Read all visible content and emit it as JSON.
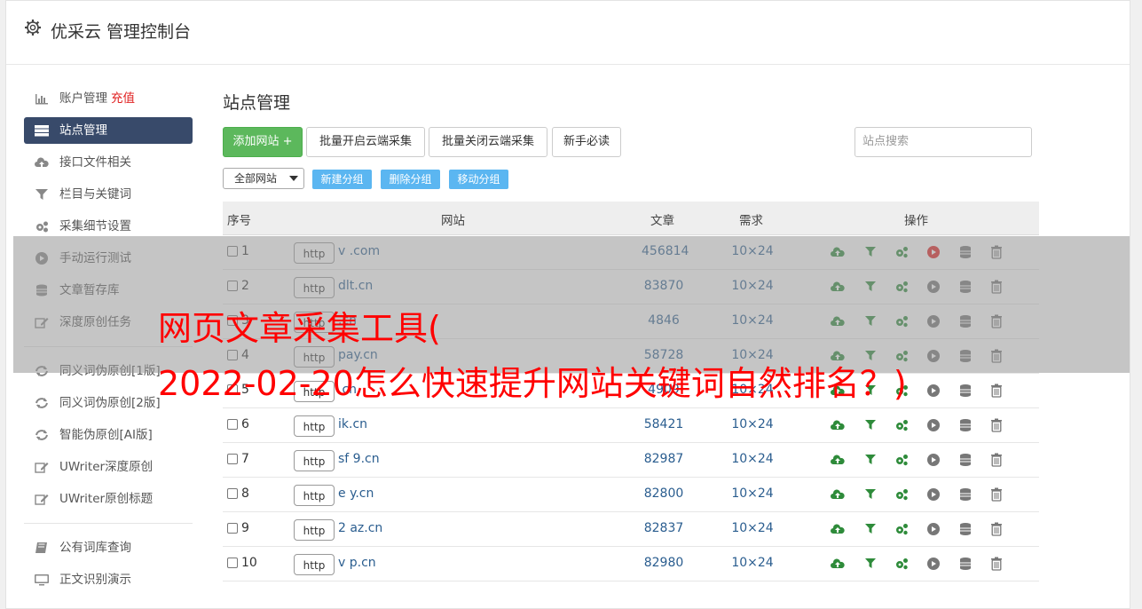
{
  "header": {
    "title": "优采云 管理控制台"
  },
  "sidebar": {
    "items": [
      {
        "label": "账户管理",
        "extra": "充值",
        "icon": "bar-chart-icon"
      },
      {
        "label": "站点管理",
        "icon": "server-icon",
        "active": true
      },
      {
        "label": "接口文件相关",
        "icon": "cloud-upload-icon"
      },
      {
        "label": "栏目与关键词",
        "icon": "filter-icon"
      },
      {
        "label": "采集细节设置",
        "icon": "gears-icon"
      },
      {
        "label": "手动运行测试",
        "icon": "play-icon"
      },
      {
        "label": "文章暂存库",
        "icon": "database-icon"
      },
      {
        "label": "深度原创任务",
        "icon": "edit-icon"
      },
      {
        "label": "同义词伪原创[1版]",
        "icon": "refresh-icon"
      },
      {
        "label": "同义词伪原创[2版]",
        "icon": "refresh-icon"
      },
      {
        "label": "智能伪原创[AI版]",
        "icon": "refresh-icon"
      },
      {
        "label": "UWriter深度原创",
        "icon": "edit-icon"
      },
      {
        "label": "UWriter原创标题",
        "icon": "edit-icon"
      },
      {
        "label": "公有词库查询",
        "icon": "book-icon"
      },
      {
        "label": "正文识别演示",
        "icon": "monitor-icon"
      }
    ]
  },
  "main": {
    "title": "站点管理",
    "toolbar": {
      "add": "添加网站 +",
      "batch_open": "批量开启云端采集",
      "batch_close": "批量关闭云端采集",
      "newbie": "新手必读",
      "search_placeholder": "站点搜索"
    },
    "group": {
      "select_value": "全部网站",
      "new_group": "新建分组",
      "delete_group": "删除分组",
      "move_group": "移动分组"
    },
    "table": {
      "headers": [
        "序号",
        "网站",
        "文章",
        "需求",
        "操作"
      ],
      "rows": [
        {
          "no": "1",
          "proto": "http",
          "site": "v           .com",
          "articles": "456814",
          "demand": "10×24"
        },
        {
          "no": "2",
          "proto": "http",
          "site": "      dlt.cn",
          "articles": "83870",
          "demand": "10×24"
        },
        {
          "no": "3",
          "proto": "http",
          "site": "          .cn",
          "articles": "4846",
          "demand": "10×24"
        },
        {
          "no": "4",
          "proto": "http",
          "site": "        pay.cn",
          "articles": "58728",
          "demand": "10×24"
        },
        {
          "no": "5",
          "proto": "http",
          "site": "         .cn",
          "articles": "4909",
          "demand": "10×24"
        },
        {
          "no": "6",
          "proto": "http",
          "site": "      ik.cn",
          "articles": "58421",
          "demand": "10×24"
        },
        {
          "no": "7",
          "proto": "http",
          "site": "sf   9.cn",
          "articles": "82987",
          "demand": "10×24"
        },
        {
          "no": "8",
          "proto": "http",
          "site": "e      y.cn",
          "articles": "82800",
          "demand": "10×24"
        },
        {
          "no": "9",
          "proto": "http",
          "site": "2      az.cn",
          "articles": "82837",
          "demand": "10×24"
        },
        {
          "no": "10",
          "proto": "http",
          "site": "v     p.cn",
          "articles": "82980",
          "demand": "10×24"
        }
      ]
    }
  },
  "overlay": {
    "line1": "网页文章采集工具(",
    "line2": "2022-02-20怎么快速提升网站关键词自然排名？)"
  },
  "colors": {
    "active_bg": "#384a6a",
    "green": "#5cb85c",
    "link_blue": "#2a5d8f",
    "overlay_text": "#ff0000",
    "small_btn": "#5bb6f1"
  }
}
